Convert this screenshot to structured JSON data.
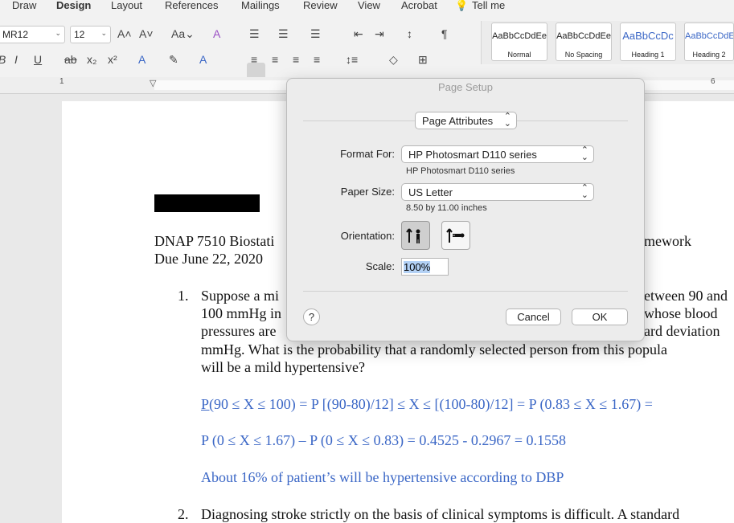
{
  "ribbon_tabs": [
    "Draw",
    "Design",
    "Layout",
    "References",
    "Mailings",
    "Review",
    "View",
    "Acrobat",
    "Tell me"
  ],
  "font_name": "MR12",
  "font_size": "12",
  "styles": [
    {
      "preview": "AaBbCcDdEe",
      "name": "Normal"
    },
    {
      "preview": "AaBbCcDdEe",
      "name": "No Spacing"
    },
    {
      "preview": "AaBbCcDc",
      "name": "Heading 1"
    },
    {
      "preview": "AaBbCcDdE",
      "name": "Heading 2"
    }
  ],
  "ruler": {
    "n1": "1",
    "n6": "6"
  },
  "document": {
    "header_line1_start": "DNAP 7510 Biostati",
    "header_line1_end": "mework",
    "header_line2": "Due June 22, 2020",
    "q1_number": "1.",
    "q1_lines": [
      "Suppose a mi",
      "100 mmHg in",
      "pressures are",
      "mmHg. What is the probability that a randomly selected person from this popula",
      "will be a mild hypertensive?"
    ],
    "q1_right": [
      "etween 90 and",
      "whose blood",
      "ard deviation"
    ],
    "answer_line1_prefix": "P(",
    "answer_line1": "90 ≤ X ≤ 100) = P [(90-80)/12] ≤ X ≤ [(100-80)/12] = P (0.83 ≤ X ≤ 1.67) =",
    "answer_line2": "P (0 ≤ X ≤ 1.67) – P (0 ≤ X ≤ 0.83) = 0.4525 - 0.2967 = 0.1558",
    "answer_line3": "About 16% of patient’s will be hypertensive according to DBP",
    "q2_number": "2.",
    "q2_line": "Diagnosing stroke strictly on the basis of clinical symptoms is difficult. A standard"
  },
  "dialog": {
    "title": "Page Setup",
    "section": "Page Attributes",
    "format_for_label": "Format For:",
    "format_for_value": "HP Photosmart D110 series",
    "format_for_sub": "HP Photosmart D110 series",
    "paper_size_label": "Paper Size:",
    "paper_size_value": "US Letter",
    "paper_size_sub": "8.50 by 11.00 inches",
    "orientation_label": "Orientation:",
    "scale_label": "Scale:",
    "scale_value": "100%",
    "help": "?",
    "cancel": "Cancel",
    "ok": "OK"
  }
}
